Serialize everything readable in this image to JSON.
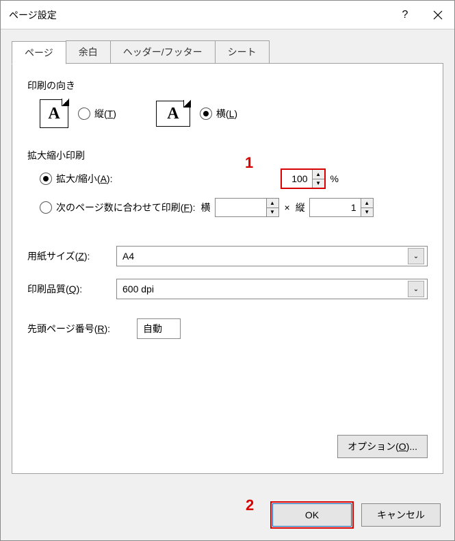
{
  "title": "ページ設定",
  "tabs": [
    "ページ",
    "余白",
    "ヘッダー/フッター",
    "シート"
  ],
  "orientation": {
    "group": "印刷の向き",
    "portrait_prefix": "縦(",
    "portrait_key": "T",
    "portrait_suffix": ")",
    "landscape_prefix": "横(",
    "landscape_key": "L",
    "landscape_suffix": ")",
    "selected": "landscape"
  },
  "scaling": {
    "group": "拡大縮小印刷",
    "adjust_prefix": "拡大/縮小(",
    "adjust_key": "A",
    "adjust_suffix": "):",
    "adjust_value": "100",
    "percent": "%",
    "fit_prefix": "次のページ数に合わせて印刷(",
    "fit_key": "F",
    "fit_suffix": "):",
    "wide_label": "横",
    "wide_value": "",
    "times": "×",
    "tall_label": "縦",
    "tall_value": "1",
    "selected": "adjust"
  },
  "paper": {
    "size_prefix": "用紙サイズ(",
    "size_key": "Z",
    "size_suffix": "):",
    "size_value": "A4",
    "quality_prefix": "印刷品質(",
    "quality_key": "Q",
    "quality_suffix": "):",
    "quality_value": "600 dpi"
  },
  "firstpage": {
    "label_prefix": "先頭ページ番号(",
    "label_key": "R",
    "label_suffix": "):",
    "value": "自動"
  },
  "options": {
    "prefix": "オプション(",
    "key": "O",
    "suffix": ")..."
  },
  "footer": {
    "ok": "OK",
    "cancel": "キャンセル"
  },
  "callouts": {
    "c1": "1",
    "c2": "2"
  }
}
